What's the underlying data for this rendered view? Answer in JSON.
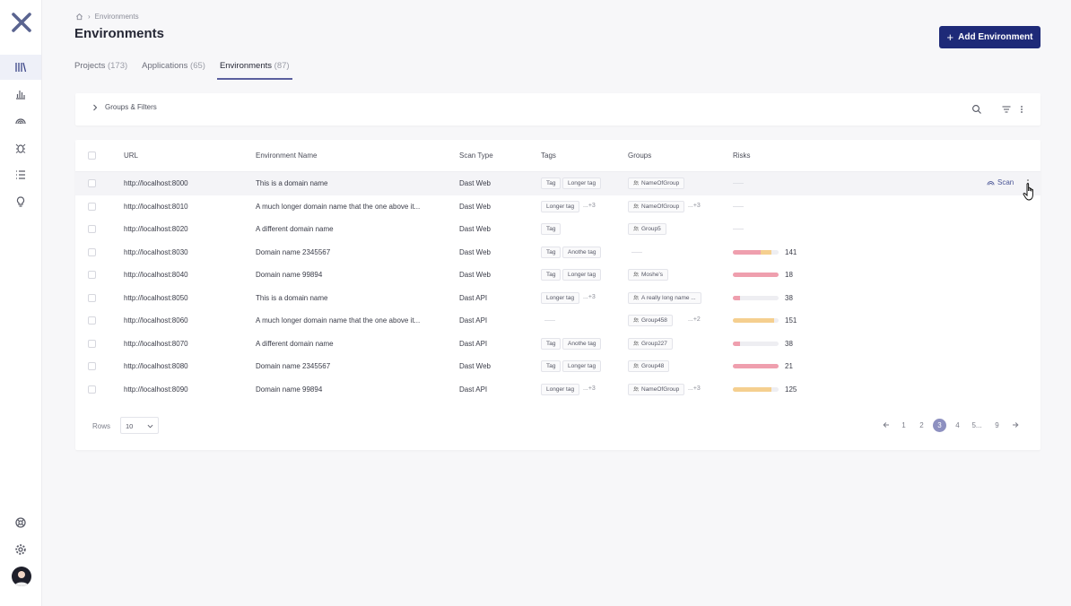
{
  "breadcrumb": {
    "current": "Environments"
  },
  "header": {
    "title": "Environments",
    "add_button": "Add Environment"
  },
  "tabs": [
    {
      "label": "Projects",
      "count": "(173)"
    },
    {
      "label": "Applications",
      "count": "(65)"
    },
    {
      "label": "Environments",
      "count": "(87)"
    }
  ],
  "filters": {
    "toggle_label": "Groups & Filters"
  },
  "table": {
    "columns": [
      "URL",
      "Environment Name",
      "Scan Type",
      "Tags",
      "Groups",
      "Risks"
    ],
    "scan_label": "Scan",
    "rows": [
      {
        "url": "http://localhost:8000",
        "name": "This is a domain name",
        "scan_type": "Dast Web",
        "tags": [
          "Tag",
          "Longer tag"
        ],
        "tags_more": "",
        "groups": [
          "NameOfGroup"
        ],
        "groups_more": "",
        "risk": ""
      },
      {
        "url": "http://localhost:8010",
        "name": "A much longer domain name that the one above it...",
        "scan_type": "Dast Web",
        "tags": [
          "Longer tag"
        ],
        "tags_more": "...+3",
        "groups": [
          "NameOfGroup"
        ],
        "groups_more": "...+3",
        "risk": ""
      },
      {
        "url": "http://localhost:8020",
        "name": "A different domain name",
        "scan_type": "Dast Web",
        "tags": [
          "Tag"
        ],
        "tags_more": "",
        "groups": [
          "Group5"
        ],
        "groups_more": "",
        "risk": ""
      },
      {
        "url": "http://localhost:8030",
        "name": "Domain name 2345567",
        "scan_type": "Dast Web",
        "tags": [
          "Tag",
          "Anothe tag"
        ],
        "tags_more": "",
        "groups": [],
        "groups_more": "",
        "risk": "141"
      },
      {
        "url": "http://localhost:8040",
        "name": "Domain name 99894",
        "scan_type": "Dast Web",
        "tags": [
          "Tag",
          "Longer tag"
        ],
        "tags_more": "",
        "groups": [
          "Moshe's"
        ],
        "groups_more": "",
        "risk": "18"
      },
      {
        "url": "http://localhost:8050",
        "name": "This is a domain name",
        "scan_type": "Dast API",
        "tags": [
          "Longer tag"
        ],
        "tags_more": "...+3",
        "groups": [
          "A really long name ..."
        ],
        "groups_more": "",
        "risk": "38"
      },
      {
        "url": "http://localhost:8060",
        "name": "A much longer domain name that the one above it...",
        "scan_type": "Dast API",
        "tags": [],
        "tags_more": "",
        "groups": [
          "Group458"
        ],
        "groups_more": "...+2",
        "risk": "151"
      },
      {
        "url": "http://localhost:8070",
        "name": "A different domain name",
        "scan_type": "Dast API",
        "tags": [
          "Tag",
          "Anothe tag"
        ],
        "tags_more": "",
        "groups": [
          "Group227"
        ],
        "groups_more": "",
        "risk": "38"
      },
      {
        "url": "http://localhost:8080",
        "name": "Domain name 2345567",
        "scan_type": "Dast Web",
        "tags": [
          "Tag",
          "Longer tag"
        ],
        "tags_more": "",
        "groups": [
          "Group48"
        ],
        "groups_more": "",
        "risk": "21"
      },
      {
        "url": "http://localhost:8090",
        "name": "Domain name 99894",
        "scan_type": "Dast API",
        "tags": [
          "Longer tag"
        ],
        "tags_more": "...+3",
        "groups": [
          "NameOfGroup"
        ],
        "groups_more": "...+3",
        "risk": "125"
      }
    ]
  },
  "risk_colors": {
    "high": "#ef9fae",
    "medium": "#f5cf8f",
    "low": "#eeeef2"
  },
  "risk_bars": [
    [],
    [],
    [],
    [
      {
        "c": "high",
        "w": 0.6
      },
      {
        "c": "medium",
        "w": 0.25
      }
    ],
    [
      {
        "c": "high",
        "w": 1.0
      }
    ],
    [
      {
        "c": "high",
        "w": 0.15
      }
    ],
    [
      {
        "c": "medium",
        "w": 0.9
      }
    ],
    [
      {
        "c": "high",
        "w": 0.15
      }
    ],
    [
      {
        "c": "high",
        "w": 1.0
      }
    ],
    [
      {
        "c": "medium",
        "w": 0.85
      }
    ]
  ],
  "footer": {
    "rows_label": "Rows",
    "rows_value": "10",
    "pages": [
      "1",
      "2",
      "3",
      "4",
      "5...",
      "9"
    ],
    "current_page": "3"
  },
  "colors": {
    "accent": "#1e2a78",
    "page_active": "#8d90c0"
  }
}
